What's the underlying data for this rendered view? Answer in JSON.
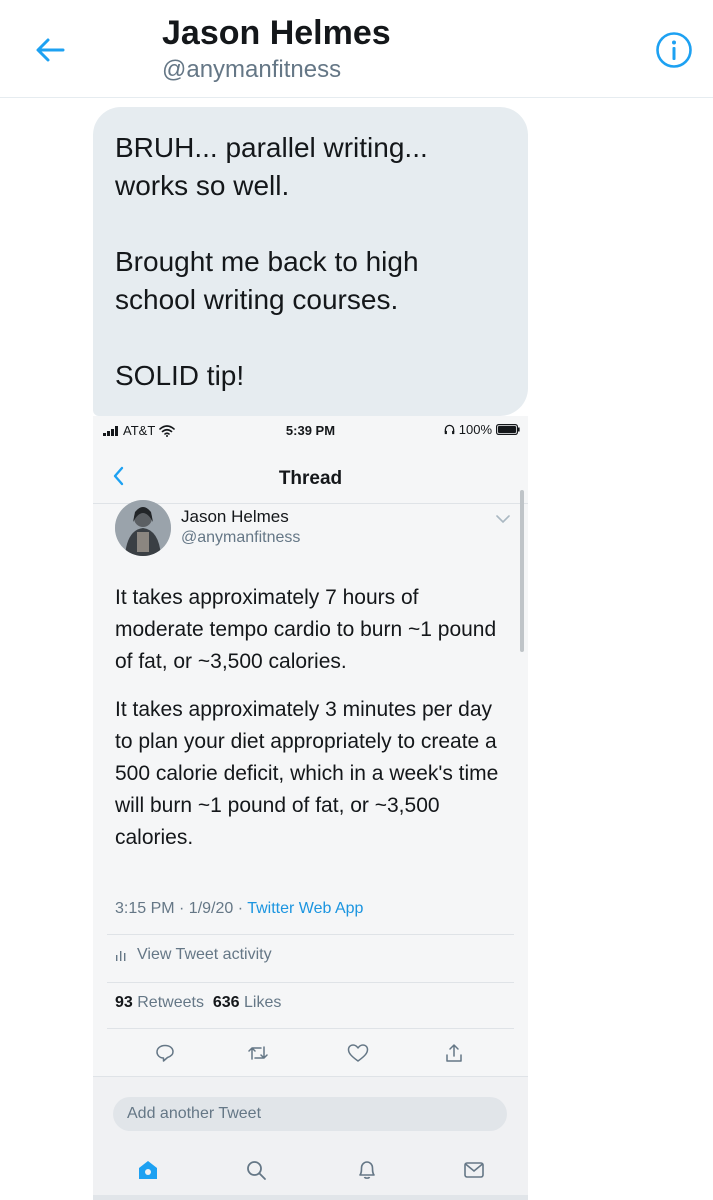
{
  "header": {
    "name": "Jason Helmes",
    "handle": "@anymanfitness"
  },
  "message": {
    "text": "BRUH... parallel writing...\nworks so well.\n\nBrought me back to high\nschool writing courses.\n\nSOLID tip!"
  },
  "screenshot": {
    "status_bar": {
      "carrier": "AT&T",
      "time": "5:39 PM",
      "battery": "100%"
    },
    "nav_title": "Thread",
    "tweet": {
      "name": "Jason Helmes",
      "handle": "@anymanfitness",
      "paragraphs": [
        "It takes approximately 7 hours of moderate tempo cardio to burn ~1 pound of fat, or ~3,500 calories.",
        "It takes approximately 3 minutes per day to plan your diet appropriately to create a 500 calorie deficit, which in a week's time will burn ~1 pound of fat, or ~3,500 calories."
      ],
      "timestamp": "3:15 PM · 1/9/20 · ",
      "source": "Twitter Web App",
      "activity_label": "View Tweet activity",
      "retweets_count": "93",
      "retweets_label": "Retweets",
      "likes_count": "636",
      "likes_label": "Likes"
    },
    "composer_placeholder": "Add another Tweet",
    "icons": [
      "reply-icon",
      "retweet-icon",
      "like-icon",
      "share-icon",
      "home-icon",
      "search-icon",
      "notifications-icon",
      "messages-icon"
    ]
  },
  "colors": {
    "accent": "#1da1f2",
    "bubble": "#e6ecf0",
    "muted": "#657786"
  }
}
